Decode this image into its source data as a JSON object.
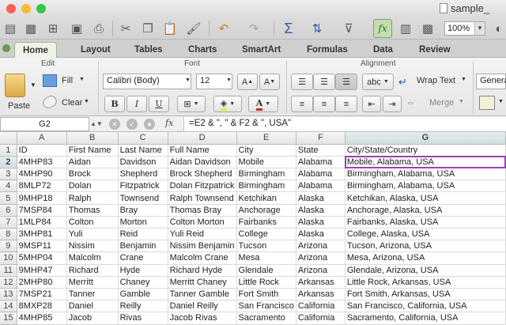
{
  "window": {
    "title": "sample_"
  },
  "toolbar": {
    "zoom": "100%",
    "icons": [
      "new-icon",
      "open-icon",
      "templates-icon",
      "save-icon",
      "print-icon",
      "cut-icon",
      "copy-icon",
      "paste-icon",
      "format-painter-icon",
      "undo-icon",
      "redo-icon",
      "autosum-icon",
      "sort-icon",
      "filter-icon",
      "formula-builder-icon",
      "show-toolbox-icon",
      "gallery-icon",
      "help-icon"
    ]
  },
  "tabs": [
    "Home",
    "Layout",
    "Tables",
    "Charts",
    "SmartArt",
    "Formulas",
    "Data",
    "Review"
  ],
  "ribbon": {
    "edit": {
      "label": "Edit",
      "fill": "Fill",
      "clear": "Clear",
      "paste": "Paste"
    },
    "font": {
      "label": "Font",
      "name": "Calibri (Body)",
      "size": "12",
      "bold": "B",
      "italic": "I",
      "underline": "U"
    },
    "alignment": {
      "label": "Alignment",
      "wrap": "Wrap Text",
      "merge": "Merge",
      "orientation": "abc"
    },
    "number": {
      "format": "Genera"
    }
  },
  "formula_bar": {
    "cell": "G2",
    "fx": "fx",
    "formula": "=E2 & \", \" & F2 & \", USA\""
  },
  "sheet": {
    "columns": [
      "A",
      "B",
      "C",
      "D",
      "E",
      "F",
      "G"
    ],
    "row_numbers": [
      "1",
      "2",
      "3",
      "4",
      "5",
      "6",
      "7",
      "8",
      "9",
      "10",
      "11",
      "12",
      "13",
      "14",
      "15"
    ],
    "rows": [
      [
        "ID",
        "First Name",
        "Last Name",
        "Full Name",
        "City",
        "State",
        "City/State/Country"
      ],
      [
        "4MHP83",
        "Aidan",
        "Davidson",
        "Aidan Davidson",
        "Mobile",
        "Alabama",
        "Mobile, Alabama, USA"
      ],
      [
        "4MHP90",
        " Brock",
        "Shepherd",
        " Brock Shepherd",
        "Birmingham",
        "Alabama",
        "Birmingham, Alabama, USA"
      ],
      [
        "8MLP72",
        "Dolan",
        "Fitzpatrick",
        "Dolan Fitzpatrick",
        "Birmingham",
        "Alabama",
        "Birmingham, Alabama, USA"
      ],
      [
        "9MHP18",
        "Ralph",
        "Townsend",
        "Ralph Townsend",
        "Ketchikan",
        "Alaska",
        "Ketchikan, Alaska, USA"
      ],
      [
        "7MSP84",
        "Thomas",
        "Bray",
        "Thomas Bray",
        "Anchorage",
        "Alaska",
        "Anchorage, Alaska, USA"
      ],
      [
        "1MLP84",
        "Colton",
        "Morton",
        "Colton Morton",
        "Fairbanks",
        "Alaska",
        "Fairbanks, Alaska, USA"
      ],
      [
        "3MHP81",
        "Yuli",
        "Reid",
        "Yuli Reid",
        "College",
        "Alaska",
        "College, Alaska, USA"
      ],
      [
        "9MSP11",
        "Nissim",
        "Benjamin",
        "Nissim Benjamin",
        "Tucson",
        "Arizona",
        "Tucson, Arizona, USA"
      ],
      [
        "5MHP04",
        "Malcolm",
        "Crane",
        "Malcolm Crane",
        "Mesa",
        "Arizona",
        "Mesa, Arizona, USA"
      ],
      [
        "9MHP47",
        "Richard",
        "Hyde",
        "Richard Hyde",
        "Glendale",
        "Arizona",
        "Glendale, Arizona, USA"
      ],
      [
        "2MHP80",
        "Merritt",
        "Chaney",
        "Merritt Chaney",
        "Little Rock",
        "Arkansas",
        "Little Rock, Arkansas, USA"
      ],
      [
        "7MSP21",
        "Tanner",
        "Gamble",
        "Tanner Gamble",
        "Fort Smith",
        "Arkansas",
        "Fort Smith, Arkansas, USA"
      ],
      [
        "8MXP28",
        "Daniel",
        "Reilly",
        "Daniel Reilly",
        "San Francisco",
        "California",
        "San Francisco, California, USA"
      ],
      [
        "4MHP85",
        "Jacob",
        "Rivas",
        "Jacob Rivas",
        "Sacramento",
        "California",
        "Sacramento, California, USA"
      ]
    ]
  }
}
